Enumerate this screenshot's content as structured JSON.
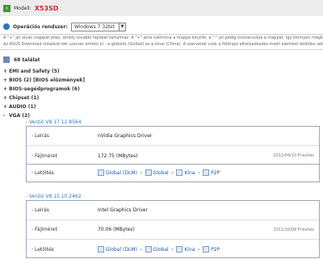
{
  "model": {
    "label": "Modell:",
    "value": "X53SD"
  },
  "os": {
    "label": "Operációs rendszer:",
    "selected": "Windows 7 32bit"
  },
  "info": {
    "line1": "A \"+\" jel olyan mappát jelez, amely további fájlokat tartalmaz. A \"+\" jelre kattintva a mappa kinyílik, a \"-\" jel pedig visszacsukja a mappát. Így könnyen megtalálhatja az",
    "line2": "Az ASUS Download oldaláról két szerver érhető el - a globális (Global) és a kínai (China). A szerverek csak a földrajzi elhelyezkedés miatt elérhető letöltési sebesség"
  },
  "results": {
    "text": "68 találat"
  },
  "categories": [
    {
      "toggle": "+",
      "label": "EMI and Safety  (5)"
    },
    {
      "toggle": "+",
      "label": "BIOS  (2) [BIOS előzmények]"
    },
    {
      "toggle": "+",
      "label": "BIOS-segédprogramok  (6)"
    },
    {
      "toggle": "+",
      "label": "Chipset  (1)"
    },
    {
      "toggle": "+",
      "label": "AUDIO  (1)"
    },
    {
      "toggle": "-",
      "label": "VGA  (2)"
    }
  ],
  "drivers": [
    {
      "version": "Verzió V8.17.12.8564",
      "desc_label": "Leírás",
      "desc_value": "nVidia Graphics Driver",
      "size_label": "Fájlméret",
      "size_value": "172.75 (MBytes)",
      "date": "2012/04/10 Frissítés",
      "dl_label": "Letöltés",
      "links": [
        "Global (DLM)",
        "Global",
        "Kína",
        "P2P"
      ]
    },
    {
      "version": "Verzió V8.15.10.2462",
      "desc_label": "Leírás",
      "desc_value": "Intel Graphics Driver",
      "size_label": "Fájlméret",
      "size_value": "70.06 (MBytes)",
      "date": "2011/10/09 Frissítés",
      "dl_label": "Letöltés",
      "links": [
        "Global (DLM)",
        "Global",
        "Kína",
        "P2P"
      ]
    }
  ]
}
